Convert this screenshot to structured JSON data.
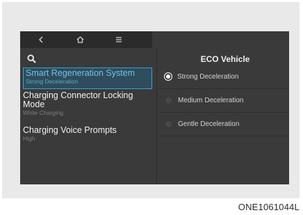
{
  "topbar": {
    "back_icon": "back-chevron-icon",
    "home_icon": "home-icon",
    "menu_icon": "menu-icon"
  },
  "search": {
    "icon": "search-icon"
  },
  "left_menu": {
    "items": [
      {
        "title": "Smart Regeneration System",
        "subtitle": "Strong Deceleration",
        "selected": true
      },
      {
        "title": "Charging Connector Locking Mode",
        "title_line1": "Charging Connector Locking",
        "title_line2": "Mode",
        "subtitle": "While Charging",
        "selected": false
      },
      {
        "title": "Charging Voice Prompts",
        "subtitle": "High",
        "selected": false
      }
    ]
  },
  "right_panel": {
    "title": "ECO Vehicle",
    "options": [
      {
        "label": "Strong Deceleration",
        "selected": true
      },
      {
        "label": "Medium Deceleration",
        "selected": false
      },
      {
        "label": "Gentle Deceleration",
        "selected": false
      }
    ]
  },
  "caption": "ONE1061044L",
  "colors": {
    "accent": "#3aa1d4",
    "screen_bg": "#3a3a3a",
    "topbar_bg": "#2b2b2b"
  }
}
